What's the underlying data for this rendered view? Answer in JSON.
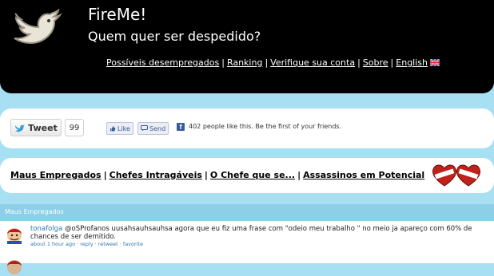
{
  "header": {
    "title": "FireMe!",
    "subtitle": "Quem quer ser despedido?",
    "nav": [
      {
        "label": "Possíveis desempregados"
      },
      {
        "label": "Ranking"
      },
      {
        "label": "Verifique sua conta"
      },
      {
        "label": "Sobre"
      },
      {
        "label": "English"
      }
    ],
    "flag_icon": "uk-flag-icon"
  },
  "social": {
    "tweet_label": "Tweet",
    "tweet_count": "99",
    "like_label": "Like",
    "send_label": "Send",
    "fb_text": "402 people like this. Be the first of your friends."
  },
  "categories": [
    {
      "label": "Maus Empregados"
    },
    {
      "label": "Chefes Intragáveis"
    },
    {
      "label": "O Chefe que se..."
    },
    {
      "label": "Assassinos em Potencial"
    }
  ],
  "section": {
    "title": "Maus Empregados",
    "items": [
      {
        "user": "tonafolga",
        "text": "@oSProfanos uusahsauhsauhsa agora que eu fiz uma frase com \"odeio meu trabalho \" no meio ja apareço com 60% de chances de ser demitido.",
        "meta": "about 1 hour ago · reply · retweet · favorite"
      }
    ]
  },
  "colors": {
    "background": "#a7dff3",
    "header": "#000000",
    "accent": "#2a7bb0"
  }
}
